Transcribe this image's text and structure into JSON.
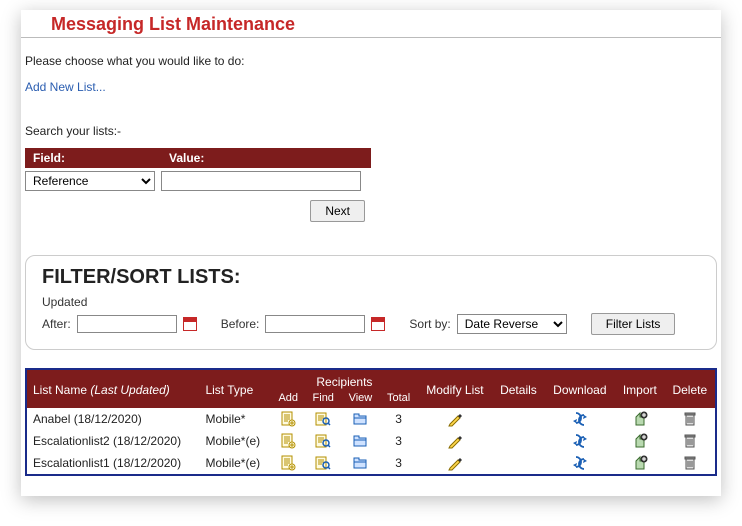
{
  "title": "Messaging List Maintenance",
  "prompt": "Please choose what you would like to do:",
  "add_link": "Add New List...",
  "search_label": "Search your lists:-",
  "search": {
    "field_header": "Field:",
    "value_header": "Value:",
    "field_options": [
      "Reference"
    ],
    "field_selected": "Reference",
    "value": "",
    "next_label": "Next"
  },
  "filter": {
    "title": "Filter/Sort Lists:",
    "updated_label": "Updated",
    "after_label": "After:",
    "after_value": "",
    "before_label": "Before:",
    "before_value": "",
    "sort_label": "Sort by:",
    "sort_options": [
      "Date Reverse"
    ],
    "sort_selected": "Date Reverse",
    "button_label": "Filter Lists"
  },
  "table": {
    "headers": {
      "list_name": "List Name",
      "last_updated": "(Last Updated)",
      "list_type": "List Type",
      "recipients": "Recipients",
      "add": "Add",
      "find": "Find",
      "view": "View",
      "total": "Total",
      "modify": "Modify List",
      "details": "Details",
      "download": "Download",
      "import": "Import",
      "delete": "Delete"
    },
    "rows": [
      {
        "name": "Anabel (18/12/2020)",
        "type": "Mobile*",
        "total": "3"
      },
      {
        "name": "Escalationlist2 (18/12/2020)",
        "type": "Mobile*(e)",
        "total": "3"
      },
      {
        "name": "Escalationlist1 (18/12/2020)",
        "type": "Mobile*(e)",
        "total": "3"
      }
    ]
  }
}
